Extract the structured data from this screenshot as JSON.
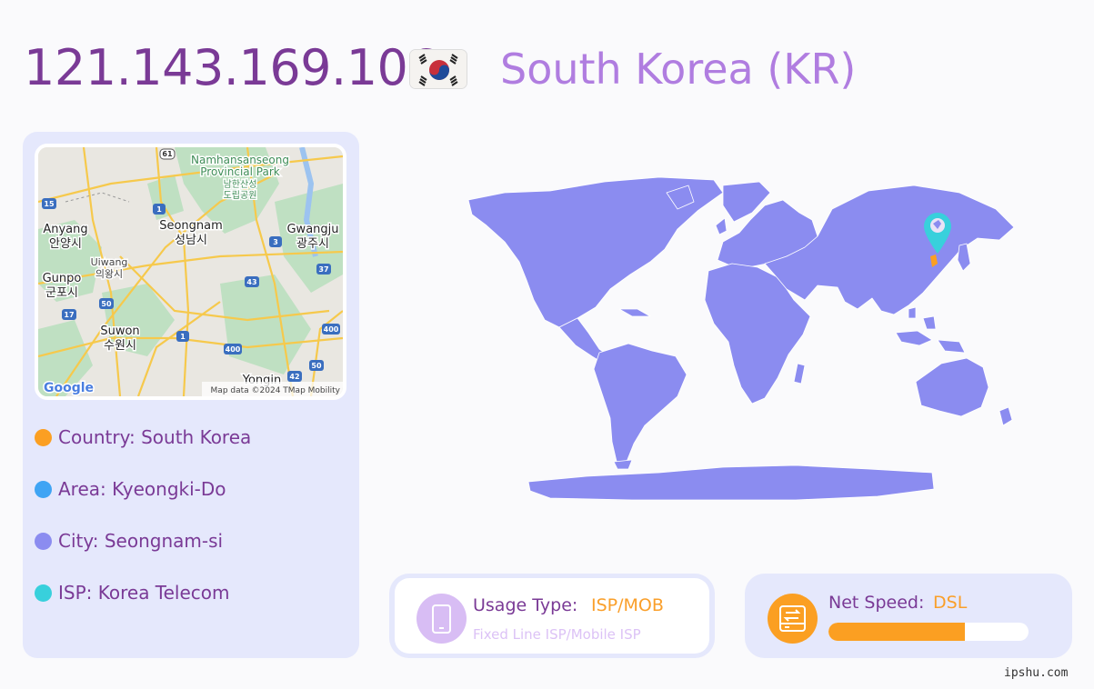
{
  "header": {
    "ip": "121.143.169.106",
    "country_title": "South Korea (KR)"
  },
  "flag": {
    "icon": "south-korea-flag-icon"
  },
  "minimap": {
    "labels": {
      "park": "Namhansanseong",
      "park2": "Provincial Park",
      "park_ko": "남한산성",
      "park_ko2": "도립공원",
      "seongnam": "Seongnam",
      "seongnam_ko": "성남시",
      "anyang": "Anyang",
      "anyang_ko": "안양시",
      "gwangju": "Gwangju",
      "gwangju_ko": "광주시",
      "uiwang": "Uiwang",
      "uiwang_ko": "의왕시",
      "gunpo": "Gunpo",
      "gunpo_ko": "군포시",
      "suwon": "Suwon",
      "suwon_ko": "수원시",
      "yongin": "Yongin"
    },
    "route_shields": [
      "61",
      "15",
      "1",
      "3",
      "37",
      "43",
      "50",
      "17",
      "1",
      "400",
      "400",
      "50",
      "42"
    ],
    "logo": "Google",
    "attribution": "Map data ©2024 TMap Mobility"
  },
  "info": [
    {
      "label": "Country: South Korea",
      "color": "#fb9f22"
    },
    {
      "label": "Area: Kyeongki-Do",
      "color": "#3fa4f4"
    },
    {
      "label": "City: Seongnam-si",
      "color": "#8b8cf0"
    },
    {
      "label": "ISP: Korea Telecom",
      "color": "#38d0dc"
    }
  ],
  "worldmap": {
    "color": "#8b8cf0",
    "marker_icon": "map-pin-icon",
    "marker_color": "#38d0dc"
  },
  "usage": {
    "label": "Usage Type:",
    "value": "ISP/MOB",
    "description": "Fixed Line ISP/Mobile ISP",
    "icon": "mobile-phone-icon"
  },
  "speed": {
    "label": "Net Speed:",
    "value": "DSL",
    "icon": "network-drive-icon",
    "level": 0.68
  },
  "watermark": "ipshu.com"
}
